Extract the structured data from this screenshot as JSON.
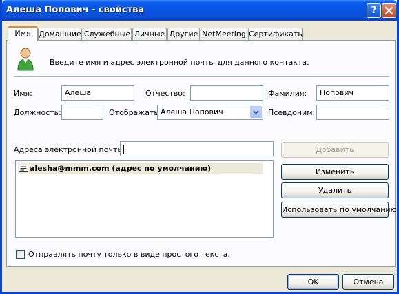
{
  "window": {
    "title": "Алеша Попович - свойства"
  },
  "tabs": [
    {
      "label": "Имя",
      "active": true
    },
    {
      "label": "Домашние"
    },
    {
      "label": "Служебные"
    },
    {
      "label": "Личные"
    },
    {
      "label": "Другие"
    },
    {
      "label": "NetMeeting"
    },
    {
      "label": "Сертификаты"
    }
  ],
  "name_tab": {
    "intro": "Введите имя и адрес электронной почты для данного контакта.",
    "first_name_label": "Имя:",
    "first_name_value": "Алеша",
    "middle_name_label": "Отчество:",
    "middle_name_value": "",
    "last_name_label": "Фамилия:",
    "last_name_value": "Попович",
    "title_label": "Должность:",
    "title_value": "",
    "display_label": "Отображать:",
    "display_value": "Алеша Попович",
    "nickname_label": "Псевдоним:",
    "nickname_value": "",
    "email_label": "Адреса электронной почты:",
    "email_input_value": "",
    "emails": [
      {
        "text": "alesha@mmm.com  (адрес по умолчанию)",
        "selected": true
      }
    ],
    "buttons": {
      "add": "Добавить",
      "edit": "Изменить",
      "remove": "Удалить",
      "set_default": "Использовать по умолчанию"
    },
    "plain_text_label": "Отправлять почту только в виде простого текста.",
    "plain_text_checked": false
  },
  "footer": {
    "ok": "OK",
    "cancel": "Отмена"
  },
  "colors": {
    "titlebar": "#0a55e2",
    "dialog": "#ece9d8",
    "active_tab_accent": "#e68b2c",
    "selection": "#ece9d8"
  }
}
